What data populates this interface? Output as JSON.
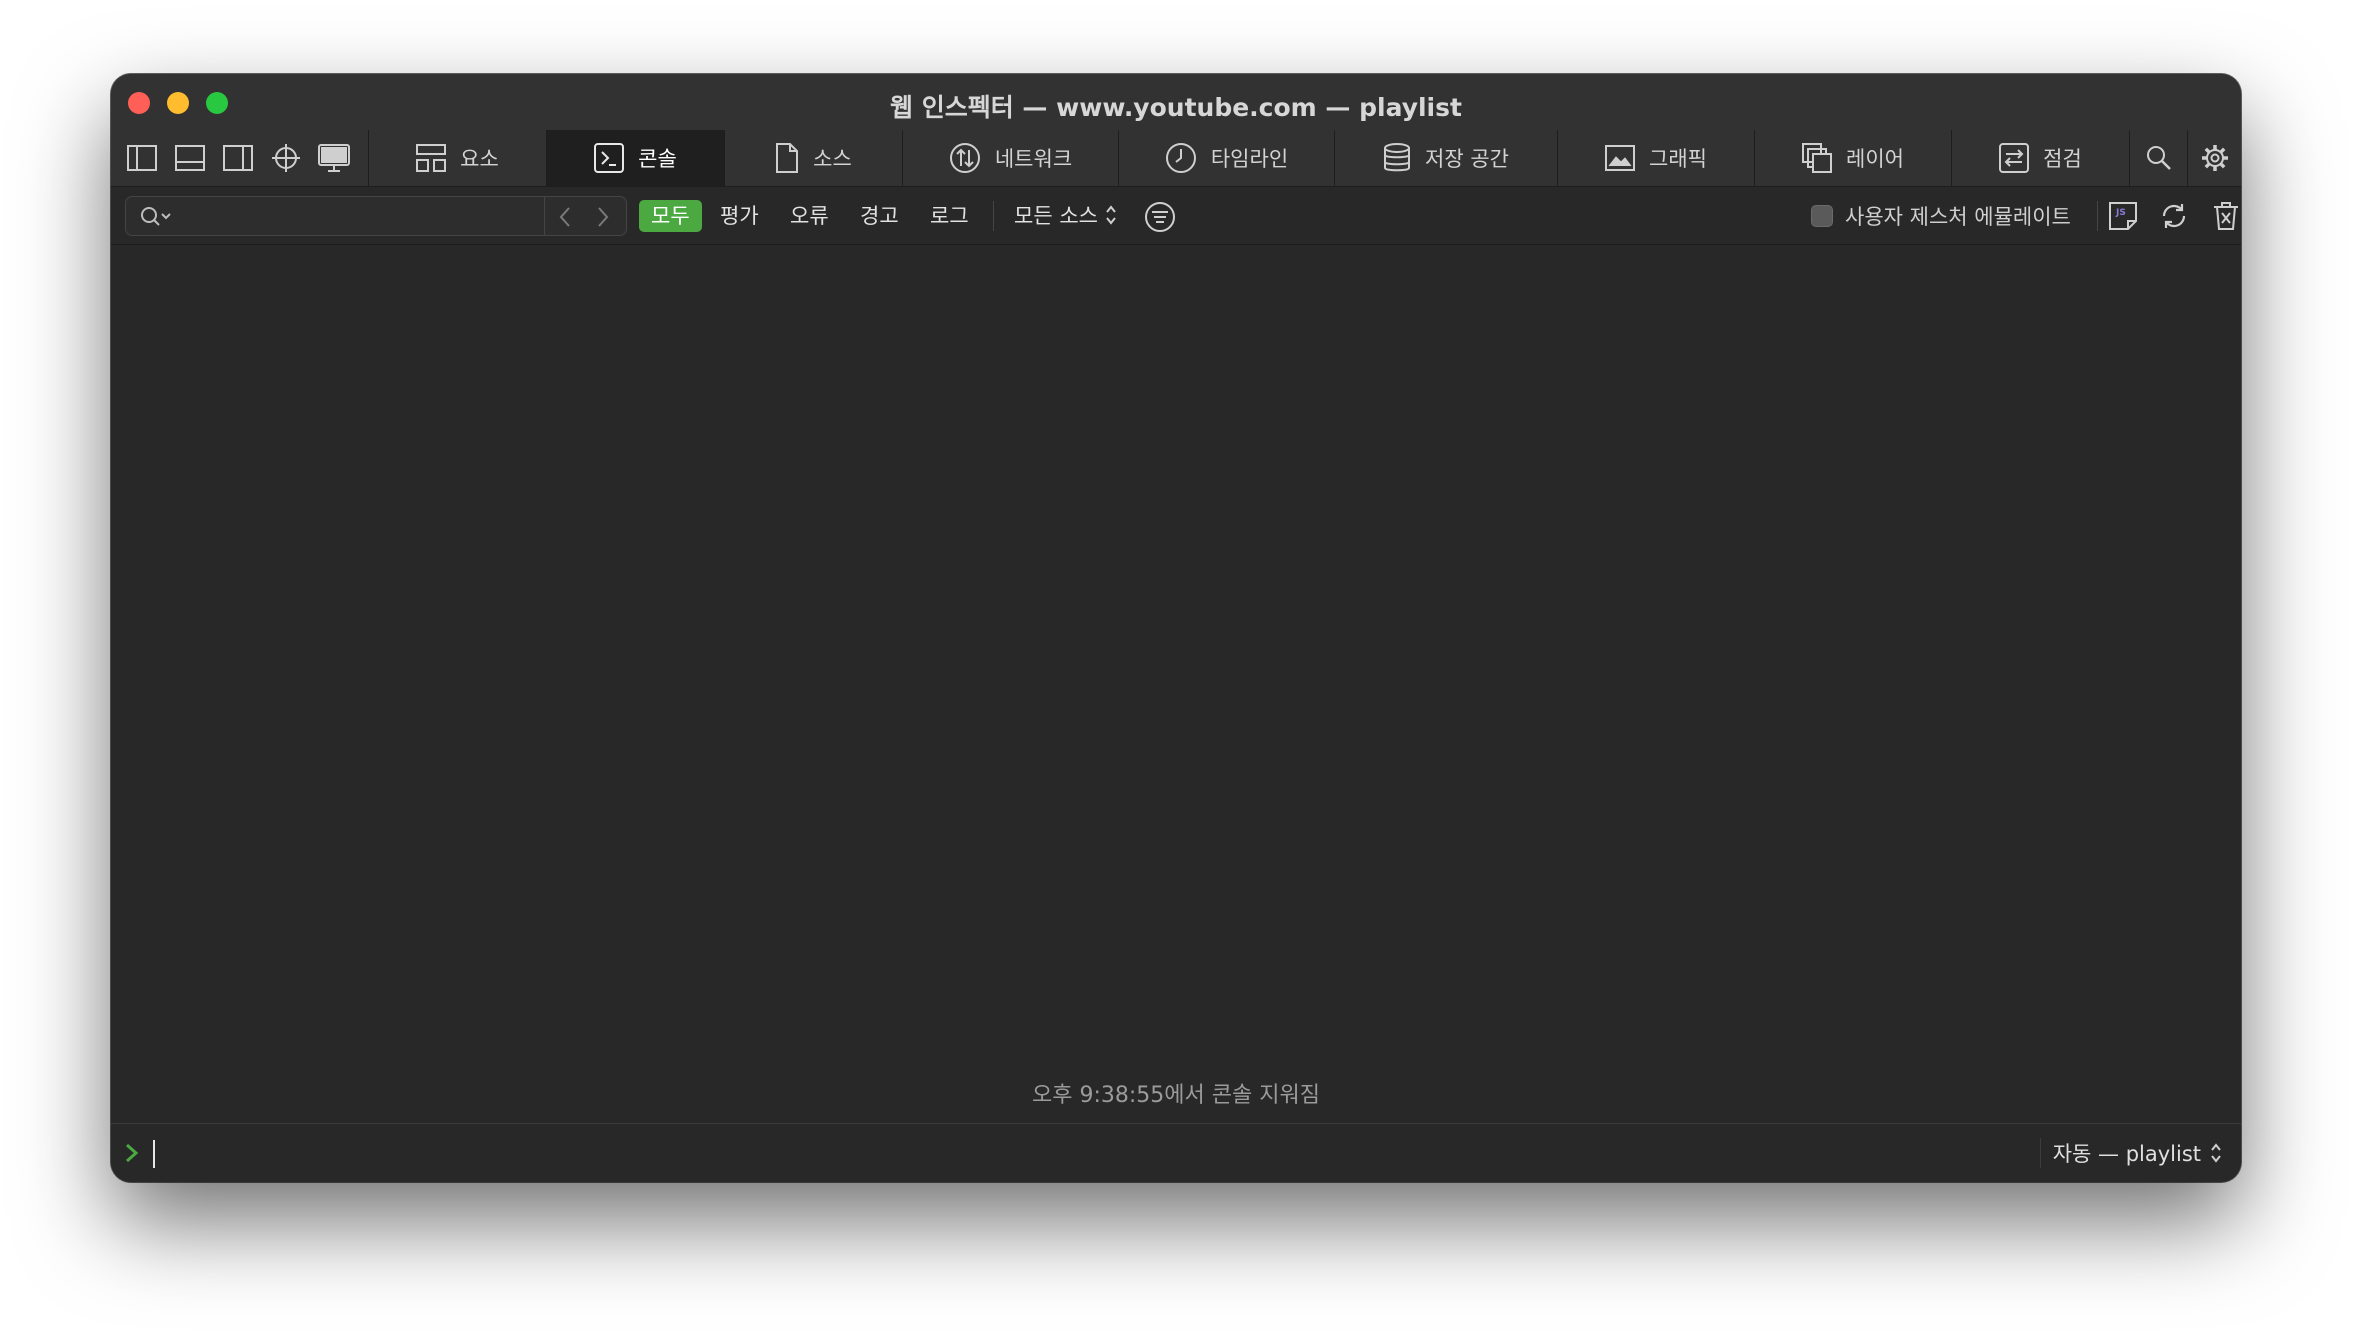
{
  "window": {
    "title": "웹 인스펙터 — www.youtube.com — playlist"
  },
  "tabs": [
    {
      "id": "elements",
      "label": "요소",
      "icon": "elements-icon"
    },
    {
      "id": "console",
      "label": "콘솔",
      "icon": "console-icon",
      "active": true
    },
    {
      "id": "sources",
      "label": "소스",
      "icon": "document-icon"
    },
    {
      "id": "network",
      "label": "네트워크",
      "icon": "network-icon"
    },
    {
      "id": "timeline",
      "label": "타임라인",
      "icon": "clock-icon"
    },
    {
      "id": "storage",
      "label": "저장 공간",
      "icon": "database-icon"
    },
    {
      "id": "graphics",
      "label": "그래픽",
      "icon": "image-icon"
    },
    {
      "id": "layers",
      "label": "레이어",
      "icon": "layers-icon"
    },
    {
      "id": "audit",
      "label": "점검",
      "icon": "audit-icon"
    }
  ],
  "filters": {
    "search_placeholder": "",
    "levels": [
      "모두",
      "평가",
      "오류",
      "경고",
      "로그"
    ],
    "active_level": "모두",
    "source_select": "모든 소스",
    "gesture_label": "사용자 제스처 에뮬레이트"
  },
  "console": {
    "cleared_message": "오후 9:38:55에서 콘솔 지워짐",
    "context_select": "자동 — playlist"
  },
  "colors": {
    "accent_green": "#4ca942",
    "window_bg": "#282828",
    "toolbar_bg": "#323232"
  }
}
